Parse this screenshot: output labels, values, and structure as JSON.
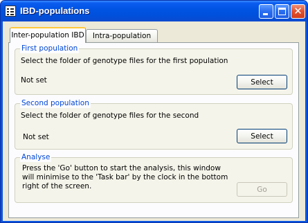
{
  "window": {
    "title": "IBD-populations",
    "icons": {
      "app": "app-icon",
      "minimize": "minimize-icon",
      "maximize": "maximize-icon",
      "close": "close-icon"
    }
  },
  "tabs": [
    {
      "label": "Inter-population IBD",
      "active": true
    },
    {
      "label": "Intra-population IBD",
      "active": false
    }
  ],
  "groups": {
    "first": {
      "title": "First population",
      "description": "Select the folder of genotype files for the first population",
      "status": "Not set",
      "button": "Select"
    },
    "second": {
      "title": "Second population",
      "description": "Select the folder of genotype files for the second",
      "status": "Not set",
      "button": "Select"
    },
    "analyse": {
      "title": "Analyse",
      "description": "Press the 'Go' button to start the analysis, this window will minimise to the 'Task bar' by the clock in the bottom right of the screen.",
      "button": "Go",
      "button_enabled": false
    }
  },
  "colors": {
    "titlebar": "#0054e3",
    "group_title": "#0046d5",
    "face": "#ece9d8",
    "tab_highlight": "#ffc83c"
  }
}
